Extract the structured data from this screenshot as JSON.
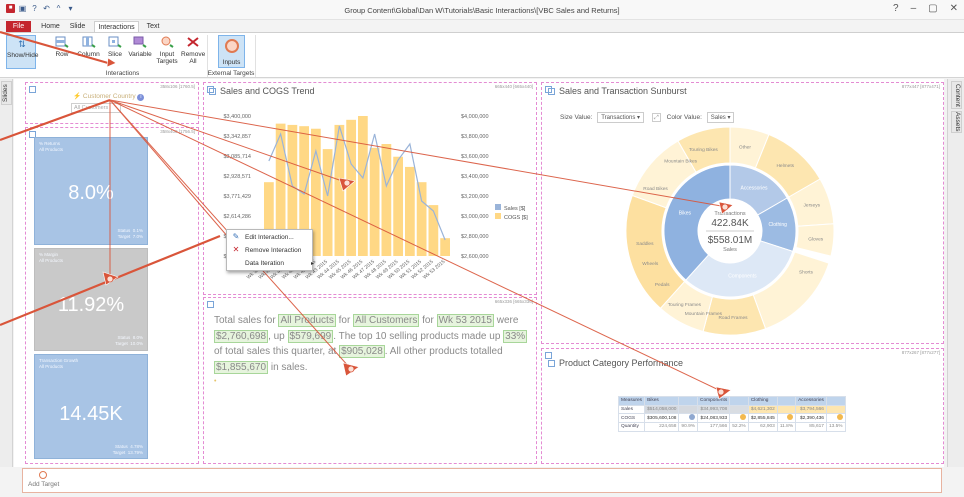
{
  "window": {
    "title": "Group Content\\Global\\Dan W\\Tutorials\\Basic Interactions\\[VBC Sales and Returns]",
    "controls": [
      "?",
      "–",
      "▢",
      "✕"
    ]
  },
  "ribbon_tabs": [
    "File",
    "Home",
    "Slide",
    "Interactions",
    "Text"
  ],
  "ribbon": {
    "show_hide": "Show/Hide",
    "buttons": [
      "Row",
      "Column",
      "Slice",
      "Variable",
      "Input Targets",
      "Remove All"
    ],
    "group_interactions": "Interactions",
    "inputs_button": "Inputs",
    "group_external": "External Targets"
  },
  "side_tabs": {
    "left": "Slides",
    "right_top": "Content",
    "right_bottom": "Assets"
  },
  "filter_panel": {
    "coord": "358x106 [1760.5]",
    "label": "Customer Country",
    "value": "All Customers"
  },
  "kpi_panel": {
    "coord": "358x400 [1756.5]",
    "cards": [
      {
        "label": "% Returns\nAll Products",
        "value": "8.0%",
        "status": "Status  0.1%\nTarget  7.0%",
        "color": "#a8c4e5"
      },
      {
        "label": "% Margin\nAll Products",
        "value": "11.92%",
        "status": "Status  8.0%\nTarget  10.0%",
        "color": "#c9c9c9"
      },
      {
        "label": "Transaction Growth\nAll Products",
        "value": "14.45K",
        "status": "Status  4.78%\nTarget  13.79%",
        "color": "#a8c4e5"
      }
    ]
  },
  "trend_chart": {
    "title": "Sales and COGS Trend",
    "coord": "665x440 [665x440]",
    "left_axis": [
      "$3,400,000",
      "$3,342,857",
      "$3,085,714",
      "$2,928,571",
      "$3,771,429",
      "$2,614,286",
      "$2,457,143",
      "$2,300,000"
    ],
    "right_axis": [
      "$4,000,000",
      "$3,800,000",
      "$3,600,000",
      "$3,400,000",
      "$3,200,000",
      "$3,000,000",
      "$2,800,000",
      "$2,600,000"
    ],
    "legend": [
      {
        "name": "Sales",
        "suffix": "[$]",
        "color": "#9ab4d9"
      },
      {
        "name": "COGS",
        "suffix": "[$]",
        "color": "#ffd885"
      }
    ],
    "x_labels": [
      "Wk 38 2015",
      "Wk 39 2015",
      "Wk 40 2015",
      "Wk 41 2015",
      "Wk 42 2015",
      "Wk 43 2015",
      "Wk 44 2015",
      "Wk 45 2015",
      "Wk 46 2015",
      "Wk 47 2015",
      "Wk 48 2015",
      "Wk 49 2015",
      "Wk 50 2015",
      "Wk 51 2015",
      "Wk 52 2015",
      "Wk 53 2015"
    ]
  },
  "chart_data": {
    "type": "bar",
    "title": "Sales and COGS Trend",
    "categories": [
      "Wk 38 2015",
      "Wk 39 2015",
      "Wk 40 2015",
      "Wk 41 2015",
      "Wk 42 2015",
      "Wk 43 2015",
      "Wk 44 2015",
      "Wk 45 2015",
      "Wk 46 2015",
      "Wk 47 2015",
      "Wk 48 2015",
      "Wk 49 2015",
      "Wk 50 2015",
      "Wk 51 2015",
      "Wk 52 2015",
      "Wk 53 2015"
    ],
    "series": [
      {
        "name": "COGS",
        "type": "bar",
        "axis": "left",
        "values": [
          2880000,
          3340000,
          3330000,
          3320000,
          3300000,
          3140000,
          3330000,
          3370000,
          3400000,
          3150000,
          3180000,
          3080000,
          3000000,
          2880000,
          2700000,
          2440000
        ]
      },
      {
        "name": "Sales",
        "type": "line",
        "axis": "right",
        "values": [
          3550000,
          3820000,
          3300000,
          3220000,
          3650000,
          3200000,
          3900000,
          3520000,
          3380000,
          3820000,
          3300000,
          3560000,
          3720000,
          3150000,
          3050000,
          2760000
        ]
      }
    ],
    "ylim": [
      2300000,
      3400000
    ],
    "y2lim": [
      2600000,
      4000000
    ]
  },
  "context_menu": {
    "items": [
      {
        "icon": "✎",
        "label": "Edit Interaction...",
        "color": "#3a73b8"
      },
      {
        "icon": "✕",
        "label": "Remove Interaction",
        "color": "#c4262e"
      },
      {
        "icon": "",
        "label": "Data Iteration",
        "submenu": "▸"
      }
    ]
  },
  "sunburst": {
    "title": "Sales and Transaction Sunburst",
    "coord": "877x447 [877x471]",
    "size_label": "Size Value:",
    "size_value": "Transactions",
    "color_label": "Color Value:",
    "color_value": "Sales",
    "center_top_label": "Transactions",
    "center_top_value": "422.84K",
    "center_bottom_value": "$558.01M",
    "center_bottom_label": "Sales",
    "inner_labels": [
      "Accessories",
      "Clothing",
      "Bikes",
      "Components"
    ],
    "outer_labels": [
      "Touring Bikes",
      "Other",
      "Helmets",
      "Jerseys",
      "Gloves",
      "Shorts",
      "Road Frames",
      "Mountain Frames",
      "Touring Frames",
      "Pedals",
      "Wheels",
      "Saddles",
      "Road Bikes",
      "Mountain Bikes"
    ]
  },
  "storyline": {
    "coord": "665x336 [665x336]",
    "segments": [
      {
        "t": "Total sales for ",
        "s": "plain"
      },
      {
        "t": "All Products",
        "s": "hl"
      },
      {
        "t": " for ",
        "s": "plain"
      },
      {
        "t": "All Customers",
        "s": "hl"
      },
      {
        "t": " for ",
        "s": "plain"
      },
      {
        "t": "Wk 53 2015",
        "s": "hl"
      },
      {
        "t": " were ",
        "s": "plain"
      },
      {
        "t": "$2,760,698",
        "s": "hl"
      },
      {
        "t": ", up ",
        "s": "plain"
      },
      {
        "t": "$579,699",
        "s": "hl"
      },
      {
        "t": ". The top 10 selling products made up ",
        "s": "plain"
      },
      {
        "t": "33%",
        "s": "hl"
      },
      {
        "t": " of total sales this quarter, at ",
        "s": "plain"
      },
      {
        "t": "$905,028",
        "s": "hl"
      },
      {
        "t": ". All other products totalled ",
        "s": "plain"
      },
      {
        "t": "$1,855,670",
        "s": "hl"
      },
      {
        "t": " in sales.",
        "s": "plain"
      }
    ]
  },
  "category_table": {
    "title": "Product Category Performance",
    "coord": "877x267 [877x277]",
    "headers": [
      "Measures",
      "Bikes",
      "",
      "Components",
      "",
      "Clothing",
      "",
      "Accessories",
      ""
    ],
    "rows": [
      [
        "Sales",
        "$514,058,000",
        "",
        "$34,993,708",
        "",
        "$4,621,302",
        "",
        "$3,794,566",
        ""
      ],
      [
        "COGS",
        "$305,600,108",
        "",
        "$24,083,933",
        "",
        "$2,855,845",
        "",
        "$2,390,436",
        ""
      ],
      [
        "Quantity",
        "224,658",
        "90.9%",
        "177,566",
        "52.2%",
        "62,903",
        "11.8%",
        "85,617",
        "13.5%"
      ]
    ]
  },
  "tray": {
    "label": "Add Target"
  }
}
